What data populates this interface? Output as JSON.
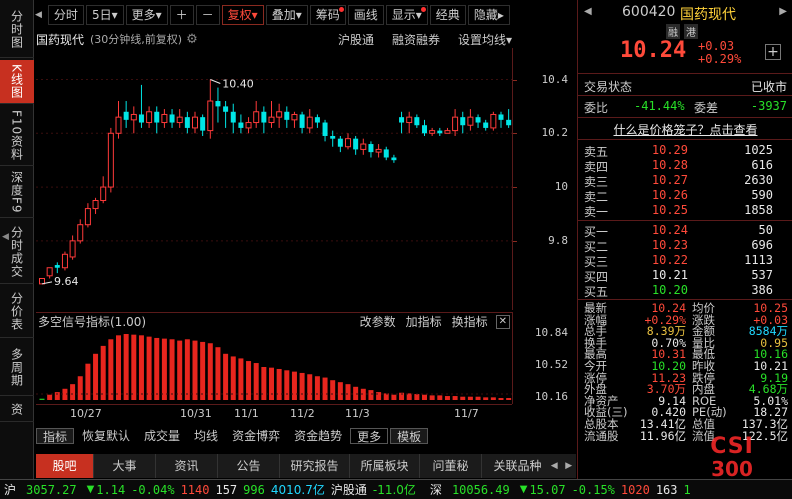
{
  "left_tabs": [
    {
      "label": "分时图",
      "active": false
    },
    {
      "label": "K线图",
      "active": true
    },
    {
      "label": "F10资料",
      "active": false
    },
    {
      "label": "深度F9",
      "active": false
    },
    {
      "label": "分时成交",
      "active": false
    },
    {
      "label": "分价表",
      "active": false
    },
    {
      "label": "多周期",
      "active": false
    },
    {
      "label": "资",
      "active": false
    }
  ],
  "toolbar": {
    "items": [
      "分时",
      "5日▾",
      "更多▾",
      "＋",
      "－",
      "复权▾",
      "叠加▾",
      "筹码",
      "画线",
      "显示▾",
      "经典",
      "隐藏▸"
    ],
    "nav_prev": "◀",
    "nav_next": "▶"
  },
  "chart_header": {
    "stock": "国药现代",
    "period": "(30分钟线,前复权)",
    "links": [
      "沪股通",
      "融资融券",
      "设置均线▾"
    ]
  },
  "chart_data": {
    "type": "candlestick",
    "ylim": [
      9.58,
      10.48
    ],
    "yticks": [
      10.4,
      10.2,
      10.0,
      9.8
    ],
    "high_label": "10.40",
    "low_label": "9.64",
    "x_ticks": [
      "10/27",
      "10/31",
      "11/1",
      "11/2",
      "11/3",
      "11/7"
    ],
    "candles": [
      [
        9.64,
        9.66,
        9.64,
        9.66
      ],
      [
        9.67,
        9.7,
        9.66,
        9.69
      ],
      [
        9.71,
        9.7,
        9.68,
        9.72
      ],
      [
        9.7,
        9.75,
        9.69,
        9.76
      ],
      [
        9.74,
        9.8,
        9.73,
        9.82
      ],
      [
        9.8,
        9.86,
        9.79,
        9.88
      ],
      [
        9.86,
        9.92,
        9.85,
        9.94
      ],
      [
        9.92,
        9.95,
        9.9,
        9.96
      ],
      [
        9.95,
        10.0,
        9.94,
        10.04
      ],
      [
        10.0,
        10.2,
        9.98,
        10.22
      ],
      [
        10.2,
        10.26,
        10.18,
        10.32
      ],
      [
        10.28,
        10.25,
        10.22,
        10.32
      ],
      [
        10.25,
        10.27,
        10.2,
        10.3
      ],
      [
        10.27,
        10.24,
        10.22,
        10.38
      ],
      [
        10.24,
        10.28,
        10.22,
        10.3
      ],
      [
        10.28,
        10.24,
        10.2,
        10.3
      ],
      [
        10.24,
        10.27,
        10.22,
        10.29
      ],
      [
        10.27,
        10.24,
        10.22,
        10.29
      ],
      [
        10.24,
        10.26,
        10.22,
        10.29
      ],
      [
        10.26,
        10.22,
        10.2,
        10.28
      ],
      [
        10.22,
        10.26,
        10.2,
        10.28
      ],
      [
        10.26,
        10.21,
        10.19,
        10.27
      ],
      [
        10.21,
        10.32,
        10.18,
        10.4
      ],
      [
        10.32,
        10.3,
        10.24,
        10.37
      ],
      [
        10.3,
        10.28,
        10.22,
        10.32
      ],
      [
        10.28,
        10.24,
        10.2,
        10.31
      ],
      [
        10.24,
        10.22,
        10.2,
        10.27
      ],
      [
        10.22,
        10.24,
        10.2,
        10.26
      ],
      [
        10.24,
        10.28,
        10.22,
        10.32
      ],
      [
        10.28,
        10.24,
        10.2,
        10.3
      ],
      [
        10.24,
        10.26,
        10.22,
        10.32
      ],
      [
        10.26,
        10.28,
        10.22,
        10.31
      ],
      [
        10.28,
        10.25,
        10.22,
        10.3
      ],
      [
        10.25,
        10.27,
        10.22,
        10.28
      ],
      [
        10.27,
        10.22,
        10.2,
        10.28
      ],
      [
        10.22,
        10.26,
        10.2,
        10.29
      ],
      [
        10.26,
        10.24,
        10.22,
        10.27
      ],
      [
        10.24,
        10.19,
        10.17,
        10.25
      ],
      [
        10.19,
        10.18,
        10.15,
        10.21
      ],
      [
        10.18,
        10.15,
        10.13,
        10.19
      ],
      [
        10.15,
        10.18,
        10.14,
        10.2
      ],
      [
        10.18,
        10.14,
        10.12,
        10.19
      ],
      [
        10.14,
        10.16,
        10.12,
        10.18
      ],
      [
        10.16,
        10.13,
        10.11,
        10.17
      ],
      [
        10.13,
        10.14,
        10.11,
        10.16
      ],
      [
        10.14,
        10.11,
        10.1,
        10.15
      ],
      [
        10.11,
        10.1,
        10.09,
        10.12
      ],
      [
        10.26,
        10.24,
        10.2,
        10.28
      ],
      [
        10.24,
        10.26,
        10.2,
        10.28
      ],
      [
        10.26,
        10.23,
        10.22,
        10.27
      ],
      [
        10.23,
        10.2,
        10.19,
        10.25
      ],
      [
        10.2,
        10.21,
        10.19,
        10.22
      ],
      [
        10.21,
        10.2,
        10.19,
        10.22
      ],
      [
        10.2,
        10.21,
        10.2,
        10.22
      ],
      [
        10.21,
        10.26,
        10.19,
        10.29
      ],
      [
        10.26,
        10.23,
        10.2,
        10.28
      ],
      [
        10.23,
        10.26,
        10.21,
        10.29
      ],
      [
        10.26,
        10.24,
        10.22,
        10.27
      ],
      [
        10.24,
        10.22,
        10.21,
        10.25
      ],
      [
        10.22,
        10.27,
        10.21,
        10.28
      ],
      [
        10.27,
        10.25,
        10.22,
        10.28
      ],
      [
        10.25,
        10.23,
        10.22,
        10.29
      ]
    ]
  },
  "indicator": {
    "title": "多空信号指标(1.00)",
    "buttons": [
      "改参数",
      "加指标",
      "换指标"
    ],
    "close": "✕",
    "axis": [
      "10.84",
      "10.52",
      "10.16"
    ],
    "bars": [
      0.02,
      0.08,
      0.12,
      0.17,
      0.24,
      0.36,
      0.55,
      0.7,
      0.82,
      0.92,
      0.98,
      1.0,
      0.99,
      0.98,
      0.96,
      0.94,
      0.93,
      0.92,
      0.9,
      0.92,
      0.9,
      0.88,
      0.86,
      0.8,
      0.7,
      0.66,
      0.63,
      0.59,
      0.56,
      0.5,
      0.49,
      0.47,
      0.45,
      0.43,
      0.41,
      0.39,
      0.36,
      0.34,
      0.3,
      0.27,
      0.24,
      0.2,
      0.17,
      0.15,
      0.12,
      0.1,
      0.08,
      0.11,
      0.1,
      0.09,
      0.08,
      0.07,
      0.07,
      0.06,
      0.06,
      0.05,
      0.05,
      0.05,
      0.04,
      0.04,
      0.03,
      0.03
    ],
    "first_bar_color": "#20c020",
    "bar_color": "#e8261e"
  },
  "bottom_tabs": {
    "items": [
      "指标",
      "恢复默认",
      "成交量",
      "均线",
      "资金博弈",
      "资金趋势",
      "更多",
      "模板"
    ],
    "selected": [
      0,
      7
    ]
  },
  "section_tabs": {
    "items": [
      "股吧",
      "大事",
      "资讯",
      "公告",
      "研究报告",
      "所属板块",
      "问董秘",
      "关联品种"
    ],
    "active": 0,
    "nav_prev": "◀",
    "nav_next": "▶"
  },
  "ticker": {
    "sh_label": "沪",
    "sh_index": "3057.27",
    "sh_arrow": "▼",
    "sh_change": "1.14",
    "sh_pct": "-0.04%",
    "sh_vol_a": "1140",
    "sh_vol_b": "157",
    "sh_vol_c": "996",
    "sh_amount": "4010.7亿",
    "hgt_label": "沪股通",
    "hgt_value": "-11.0亿",
    "sz_label": "深",
    "sz_index": "10056.49",
    "sz_arrow": "▼",
    "sz_change": "15.07",
    "sz_pct": "-0.15%",
    "sz_vol_a": "1020",
    "sz_vol_b": "163",
    "sz_vol_c": "1"
  },
  "quote": {
    "code": "600420",
    "name": "国药现代",
    "badges": [
      "融",
      "港"
    ],
    "price": "10.24",
    "change": "+0.03",
    "change_pct": "+0.29%",
    "add_button": "+",
    "trade_status_label": "交易状态",
    "trade_status": "已收市",
    "weibi_label": "委比",
    "weibi": "-41.44%",
    "weicha_label": "委差",
    "weicha": "-3937",
    "price_cage_link": "什么是价格笼子？点击查看",
    "sell": [
      {
        "name": "卖五",
        "price": "10.29",
        "vol": "1025"
      },
      {
        "name": "卖四",
        "price": "10.28",
        "vol": "616"
      },
      {
        "name": "卖三",
        "price": "10.27",
        "vol": "2630"
      },
      {
        "name": "卖二",
        "price": "10.26",
        "vol": "590"
      },
      {
        "name": "卖一",
        "price": "10.25",
        "vol": "1858"
      }
    ],
    "buy": [
      {
        "name": "买一",
        "price": "10.24",
        "vol": "50"
      },
      {
        "name": "买二",
        "price": "10.23",
        "vol": "696"
      },
      {
        "name": "买三",
        "price": "10.22",
        "vol": "1113"
      },
      {
        "name": "买四",
        "price": "10.21",
        "vol": "537"
      },
      {
        "name": "买五",
        "price": "10.20",
        "vol": "386"
      }
    ],
    "stats_left": [
      {
        "label": "最新",
        "value": "10.24",
        "color": "red"
      },
      {
        "label": "涨幅",
        "value": "+0.29%",
        "color": "red"
      },
      {
        "label": "总手",
        "value": "8.39万",
        "color": "yellow"
      },
      {
        "label": "换手",
        "value": "0.70%",
        "color": "white"
      },
      {
        "label": "最高",
        "value": "10.31",
        "color": "red"
      },
      {
        "label": "今开",
        "value": "10.20",
        "color": "green"
      },
      {
        "label": "涨停",
        "value": "11.23",
        "color": "red"
      },
      {
        "label": "外盘",
        "value": "3.70万",
        "color": "red"
      },
      {
        "label": "净资产",
        "value": "9.14",
        "color": "white"
      },
      {
        "label": "收益(三)",
        "value": "0.420",
        "color": "white"
      },
      {
        "label": "总股本",
        "value": "13.41亿",
        "color": "white"
      },
      {
        "label": "流通股",
        "value": "11.96亿",
        "color": "white"
      }
    ],
    "stats_right": [
      {
        "label": "均价",
        "value": "10.25",
        "color": "red"
      },
      {
        "label": "涨跌",
        "value": "+0.03",
        "color": "red"
      },
      {
        "label": "金额",
        "value": "8584万",
        "color": "cyan"
      },
      {
        "label": "量比",
        "value": "0.95",
        "color": "yellow"
      },
      {
        "label": "最低",
        "value": "10.16",
        "color": "green"
      },
      {
        "label": "昨收",
        "value": "10.21",
        "color": "white"
      },
      {
        "label": "跌停",
        "value": "9.19",
        "color": "green"
      },
      {
        "label": "内盘",
        "value": "4.68万",
        "color": "green"
      },
      {
        "label": "ROE",
        "value": "5.01%",
        "color": "white"
      },
      {
        "label": "PE(动)",
        "value": "18.27",
        "color": "white"
      },
      {
        "label": "总值",
        "value": "137.3亿",
        "color": "white"
      },
      {
        "label": "流值",
        "value": "122.5亿",
        "color": "white"
      }
    ],
    "watermark_top": "CSI",
    "watermark_bottom": "300"
  }
}
